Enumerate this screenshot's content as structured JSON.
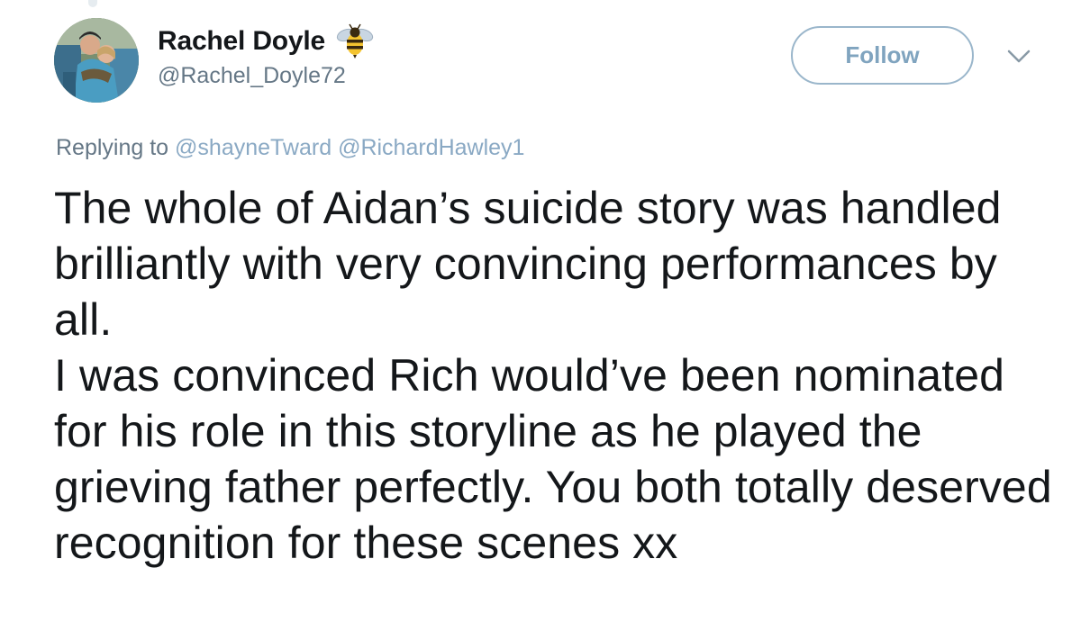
{
  "user": {
    "display_name": "Rachel Doyle",
    "handle": "@Rachel_Doyle72",
    "name_emoji_icon": "bee-icon",
    "avatar": "profile-photo"
  },
  "actions": {
    "follow_label": "Follow",
    "menu_icon": "chevron-down-icon"
  },
  "reply": {
    "prefix": "Replying to",
    "mentions": [
      "@shayneTward",
      "@RichardHawley1"
    ]
  },
  "tweet": {
    "paragraphs": [
      "The whole of Aidan’s suicide story was handled brilliantly with very convincing performances by all.",
      "I was convinced Rich would’ve been nominated for his role in this storyline as he played the grieving father perfectly. You both totally deserved recognition for these scenes xx"
    ]
  },
  "colors": {
    "text": "#14171a",
    "secondary": "#657786",
    "link": "#8aa9c4",
    "follow_border": "#9ab6cb",
    "follow_text": "#80a4bf"
  }
}
